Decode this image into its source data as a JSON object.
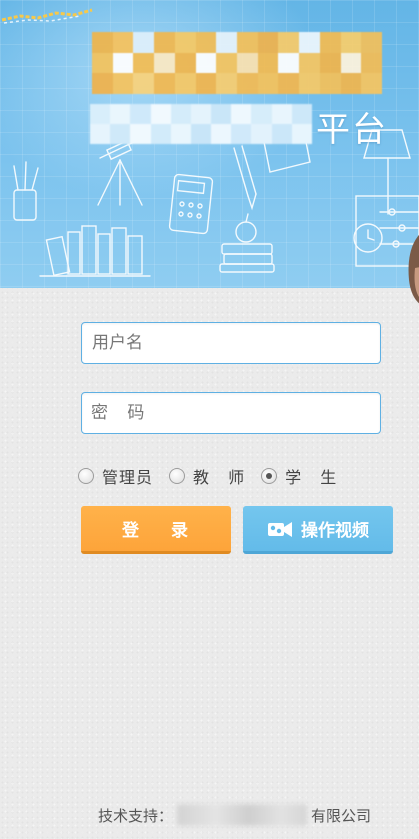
{
  "banner": {
    "title_visible": "平台",
    "colors": {
      "sky": "#63b5e6",
      "accent": "#f7b23b"
    }
  },
  "form": {
    "username_placeholder": "用户名",
    "password_placeholder": "密 码"
  },
  "roles": [
    {
      "label": "管理员",
      "checked": false
    },
    {
      "label": "教 师",
      "checked": false
    },
    {
      "label": "学 生",
      "checked": true
    }
  ],
  "buttons": {
    "login_label": "登 录",
    "video_label": "操作视频"
  },
  "footer": {
    "support_prefix": "技术支持：",
    "support_suffix": "有限公司"
  },
  "icons": [
    "video-camera-icon",
    "radio-icon"
  ]
}
